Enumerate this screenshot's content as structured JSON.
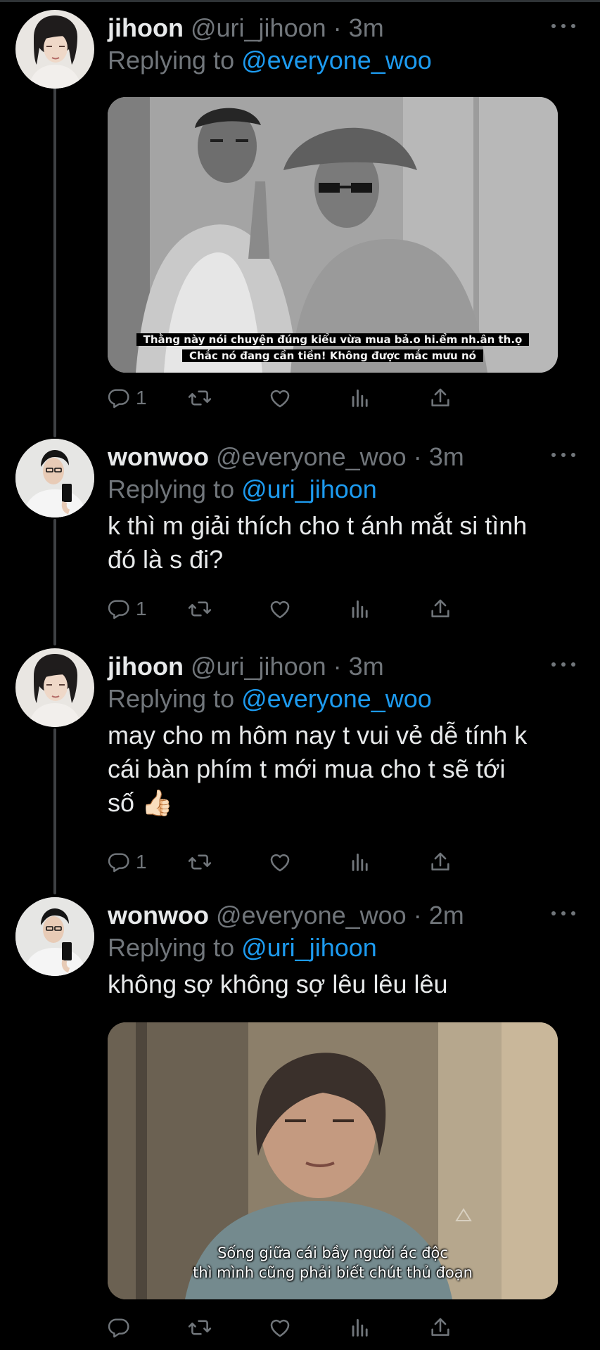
{
  "colors": {
    "background": "#000000",
    "text_primary": "#e7e9ea",
    "text_secondary": "#71767b",
    "link": "#1d9bf0",
    "thread_line": "#3e4144"
  },
  "replying_prefix": "Replying to",
  "more_icon": "more-horizontal-icon",
  "tweets": [
    {
      "name": "jihoon",
      "handle": "@uri_jihoon",
      "separator": "·",
      "time": "3m",
      "replying_to": "@everyone_woo",
      "text": "",
      "media": {
        "subtitle_line1": "Thằng này nói chuyện đúng kiểu vừa mua bả.o hi.ểm nh.ân th.ọ",
        "subtitle_line2": "Chắc nó đang cần tiền! Không được mắc mưu nó"
      },
      "actions": {
        "reply": "1",
        "retweet": "",
        "like": ""
      }
    },
    {
      "name": "wonwoo",
      "handle": "@everyone_woo",
      "separator": "·",
      "time": "3m",
      "replying_to": "@uri_jihoon",
      "text_line1": "k thì m giải thích cho t ánh mắt si tình",
      "text_line2": "đó là s đi?",
      "actions": {
        "reply": "1",
        "retweet": "",
        "like": ""
      }
    },
    {
      "name": "jihoon",
      "handle": "@uri_jihoon",
      "separator": "·",
      "time": "3m",
      "replying_to": "@everyone_woo",
      "text_line1": "may cho m hôm nay t vui vẻ dễ tính k",
      "text_line2": "cái bàn phím t mới mua cho t sẽ tới",
      "text_line3": "số 👍🏻",
      "actions": {
        "reply": "1",
        "retweet": "",
        "like": ""
      }
    },
    {
      "name": "wonwoo",
      "handle": "@everyone_woo",
      "separator": "·",
      "time": "2m",
      "replying_to": "@uri_jihoon",
      "text_line1": "không sợ không sợ lêu lêu lêu",
      "media": {
        "subtitle_line1": "Sống giữa cái bầy người ác độc",
        "subtitle_line2": "thì mình cũng phải biết chút thủ đoạn"
      },
      "actions": {
        "reply": "",
        "retweet": "",
        "like": ""
      }
    }
  ]
}
